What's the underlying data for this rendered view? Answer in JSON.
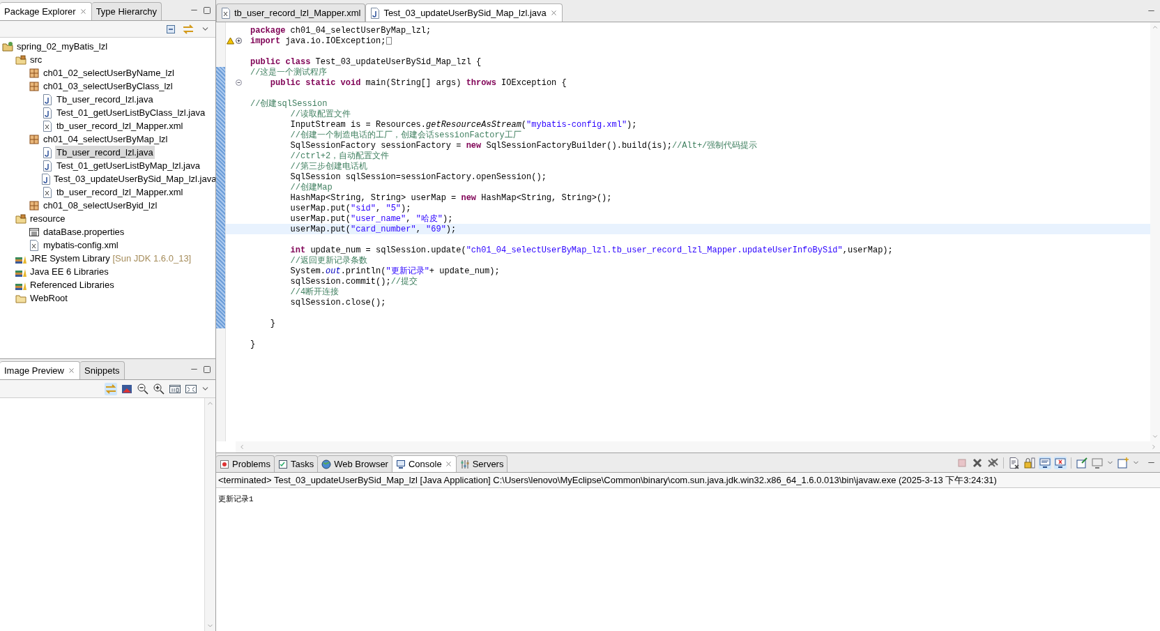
{
  "package_explorer": {
    "tabs": [
      {
        "label": "Package Explorer",
        "selected": true,
        "closable": true
      },
      {
        "label": "Type Hierarchy",
        "selected": false,
        "closable": false
      }
    ],
    "tree": [
      {
        "label": "spring_02_myBatis_lzl",
        "kind": "project",
        "selected": false,
        "children": [
          {
            "label": "src",
            "kind": "source",
            "selected": false,
            "children": [
              {
                "label": "ch01_02_selectUserByName_lzl",
                "kind": "package",
                "selected": false
              },
              {
                "label": "ch01_03_selectUserByClass_lzl",
                "kind": "package",
                "selected": false,
                "children": [
                  {
                    "label": "Tb_user_record_lzl.java",
                    "kind": "java",
                    "selected": false
                  },
                  {
                    "label": "Test_01_getUserListByClass_lzl.java",
                    "kind": "java",
                    "selected": false
                  },
                  {
                    "label": "tb_user_record_lzl_Mapper.xml",
                    "kind": "xml",
                    "selected": false
                  }
                ]
              },
              {
                "label": "ch01_04_selectUserByMap_lzl",
                "kind": "package",
                "selected": false,
                "children": [
                  {
                    "label": "Tb_user_record_lzl.java",
                    "kind": "java",
                    "selected": true
                  },
                  {
                    "label": "Test_01_getUserListByMap_lzl.java",
                    "kind": "java",
                    "selected": false
                  },
                  {
                    "label": "Test_03_updateUserBySid_Map_lzl.java",
                    "kind": "java",
                    "selected": false
                  },
                  {
                    "label": "tb_user_record_lzl_Mapper.xml",
                    "kind": "xml",
                    "selected": false
                  }
                ]
              },
              {
                "label": "ch01_08_selectUserByid_lzl",
                "kind": "package",
                "selected": false
              }
            ]
          },
          {
            "label": "resource",
            "kind": "source",
            "selected": false,
            "children": [
              {
                "label": "dataBase.properties",
                "kind": "properties",
                "selected": false
              },
              {
                "label": "mybatis-config.xml",
                "kind": "xml",
                "selected": false
              }
            ]
          },
          {
            "label": "JRE System Library",
            "detail": "[Sun JDK 1.6.0_13]",
            "kind": "library",
            "selected": false
          },
          {
            "label": "Java EE 6 Libraries",
            "kind": "library",
            "selected": false
          },
          {
            "label": "Referenced Libraries",
            "kind": "library",
            "selected": false
          },
          {
            "label": "WebRoot",
            "kind": "folder",
            "selected": false
          }
        ]
      }
    ]
  },
  "image_preview": {
    "tabs": [
      {
        "label": "Image Preview",
        "selected": true,
        "closable": true
      },
      {
        "label": "Snippets",
        "selected": false,
        "closable": false
      }
    ]
  },
  "editor": {
    "tabs": [
      {
        "label": "tb_user_record_lzl_Mapper.xml",
        "kind": "xml",
        "selected": false,
        "closable": false
      },
      {
        "label": "Test_03_updateUserBySid_Map_lzl.java",
        "kind": "java",
        "selected": true,
        "closable": true
      }
    ],
    "lines": [
      {
        "current": false,
        "segments": [
          {
            "kind": "keyword",
            "text": "package"
          },
          {
            "kind": "plain",
            "text": " ch01_04_selectUserByMap_lzl;"
          }
        ]
      },
      {
        "current": false,
        "fold_collapsed": true,
        "warning": true,
        "segments": [
          {
            "kind": "keyword",
            "text": "import"
          },
          {
            "kind": "plain",
            "text": " java.io.IOException;"
          }
        ]
      },
      {
        "current": false
      },
      {
        "current": false,
        "segments": [
          {
            "kind": "keyword",
            "text": "public class"
          },
          {
            "kind": "plain",
            "text": " Test_03_updateUserBySid_Map_lzl {"
          }
        ]
      },
      {
        "current": false,
        "segments": [
          {
            "kind": "comment",
            "text": "//这是一个测试程序"
          }
        ]
      },
      {
        "current": false,
        "fold_collapsed": false,
        "method_indent": true,
        "segments": [
          {
            "kind": "keyword",
            "text": "public static void"
          },
          {
            "kind": "plain",
            "text": " main(String[] args) "
          },
          {
            "kind": "keyword",
            "text": "throws"
          },
          {
            "kind": "plain",
            "text": " IOException {"
          }
        ]
      },
      {
        "current": false
      },
      {
        "current": false,
        "segments": [
          {
            "kind": "comment",
            "text": "//创建sqlSession"
          }
        ]
      },
      {
        "current": false,
        "body_indent": true,
        "segments": [
          {
            "kind": "comment",
            "text": "//读取配置文件"
          }
        ]
      },
      {
        "current": false,
        "body_indent": true,
        "segments": [
          {
            "kind": "plain",
            "text": "InputStream is = Resources."
          },
          {
            "kind": "italic",
            "text": "getResourceAsStream"
          },
          {
            "kind": "plain",
            "text": "("
          },
          {
            "kind": "string",
            "text": "\"mybatis-config.xml\""
          },
          {
            "kind": "plain",
            "text": ");"
          }
        ]
      },
      {
        "current": false,
        "body_indent": true,
        "segments": [
          {
            "kind": "comment",
            "text": "//创建一个制造电话的工厂，创建会话sessionFactory工厂"
          }
        ]
      },
      {
        "current": false,
        "body_indent": true,
        "segments": [
          {
            "kind": "plain",
            "text": "SqlSessionFactory sessionFactory = "
          },
          {
            "kind": "keyword",
            "text": "new"
          },
          {
            "kind": "plain",
            "text": " SqlSessionFactoryBuilder().build(is);"
          },
          {
            "kind": "comment",
            "text": "//Alt+/强制代码提示"
          }
        ]
      },
      {
        "current": false,
        "body_indent": true,
        "segments": [
          {
            "kind": "comment",
            "text": "//ctrl+2，自动配置文件"
          }
        ]
      },
      {
        "current": false,
        "body_indent": true,
        "segments": [
          {
            "kind": "comment",
            "text": "//第三步创建电话机"
          }
        ]
      },
      {
        "current": false,
        "body_indent": true,
        "segments": [
          {
            "kind": "plain",
            "text": "SqlSession sqlSession=sessionFactory.openSession();"
          }
        ]
      },
      {
        "current": false,
        "body_indent": true,
        "segments": [
          {
            "kind": "comment",
            "text": "//创建Map"
          }
        ]
      },
      {
        "current": false,
        "body_indent": true,
        "segments": [
          {
            "kind": "plain",
            "text": "HashMap<String, String> userMap = "
          },
          {
            "kind": "keyword",
            "text": "new"
          },
          {
            "kind": "plain",
            "text": " HashMap<String, String>();"
          }
        ]
      },
      {
        "current": false,
        "body_indent": true,
        "segments": [
          {
            "kind": "plain",
            "text": "userMap.put("
          },
          {
            "kind": "string",
            "text": "\"sid\""
          },
          {
            "kind": "plain",
            "text": ", "
          },
          {
            "kind": "string",
            "text": "\"5\""
          },
          {
            "kind": "plain",
            "text": ");"
          }
        ]
      },
      {
        "current": false,
        "body_indent": true,
        "segments": [
          {
            "kind": "plain",
            "text": "userMap.put("
          },
          {
            "kind": "string",
            "text": "\"user_name\""
          },
          {
            "kind": "plain",
            "text": ", "
          },
          {
            "kind": "string",
            "text": "\"哈皮\""
          },
          {
            "kind": "plain",
            "text": ");"
          }
        ]
      },
      {
        "current": true,
        "body_indent": true,
        "segments": [
          {
            "kind": "plain",
            "text": "userMap.put("
          },
          {
            "kind": "string",
            "text": "\"card_number\""
          },
          {
            "kind": "plain",
            "text": ", "
          },
          {
            "kind": "string",
            "text": "\"69\""
          },
          {
            "kind": "plain",
            "text": ");"
          }
        ]
      },
      {
        "current": false
      },
      {
        "current": false,
        "body_indent": true,
        "segments": [
          {
            "kind": "keyword",
            "text": "int"
          },
          {
            "kind": "plain",
            "text": " update_num = sqlSession.update("
          },
          {
            "kind": "string",
            "text": "\"ch01_04_selectUserByMap_lzl.tb_user_record_lzl_Mapper.updateUserInfoBySid\""
          },
          {
            "kind": "plain",
            "text": ",userMap);"
          }
        ]
      },
      {
        "current": false,
        "body_indent": true,
        "segments": [
          {
            "kind": "comment",
            "text": "//返回更新记录条数"
          }
        ]
      },
      {
        "current": false,
        "body_indent": true,
        "segments": [
          {
            "kind": "plain",
            "text": "System."
          },
          {
            "kind": "field",
            "text": "out"
          },
          {
            "kind": "plain",
            "text": ".println("
          },
          {
            "kind": "string",
            "text": "\"更新记录\""
          },
          {
            "kind": "plain",
            "text": "+ update_num);"
          }
        ]
      },
      {
        "current": false,
        "body_indent": true,
        "segments": [
          {
            "kind": "plain",
            "text": "sqlSession.commit();"
          },
          {
            "kind": "comment",
            "text": "//提交"
          }
        ]
      },
      {
        "current": false,
        "body_indent": true,
        "segments": [
          {
            "kind": "comment",
            "text": "//4断开连接"
          }
        ]
      },
      {
        "current": false,
        "body_indent": true,
        "segments": [
          {
            "kind": "plain",
            "text": "sqlSession.close();"
          }
        ]
      },
      {
        "current": false
      },
      {
        "current": false,
        "method_indent": true,
        "segments": [
          {
            "kind": "plain",
            "text": "}"
          }
        ]
      },
      {
        "current": false
      },
      {
        "current": false,
        "segments": [
          {
            "kind": "plain",
            "text": "}"
          }
        ]
      }
    ]
  },
  "console": {
    "tabs": [
      {
        "label": "Problems",
        "kind": "problems",
        "selected": false,
        "closable": false
      },
      {
        "label": "Tasks",
        "kind": "tasks",
        "selected": false,
        "closable": false
      },
      {
        "label": "Web Browser",
        "kind": "browser",
        "selected": false,
        "closable": false
      },
      {
        "label": "Console",
        "kind": "console",
        "selected": true,
        "closable": true
      },
      {
        "label": "Servers",
        "kind": "servers",
        "selected": false,
        "closable": false
      }
    ],
    "header": "<terminated> Test_03_updateUserBySid_Map_lzl [Java Application] C:\\Users\\lenovo\\MyEclipse\\Common\\binary\\com.sun.java.jdk.win32.x86_64_1.6.0.013\\bin\\javaw.exe (2025-3-13 下午3:24:31)",
    "output": "更新记录1"
  }
}
